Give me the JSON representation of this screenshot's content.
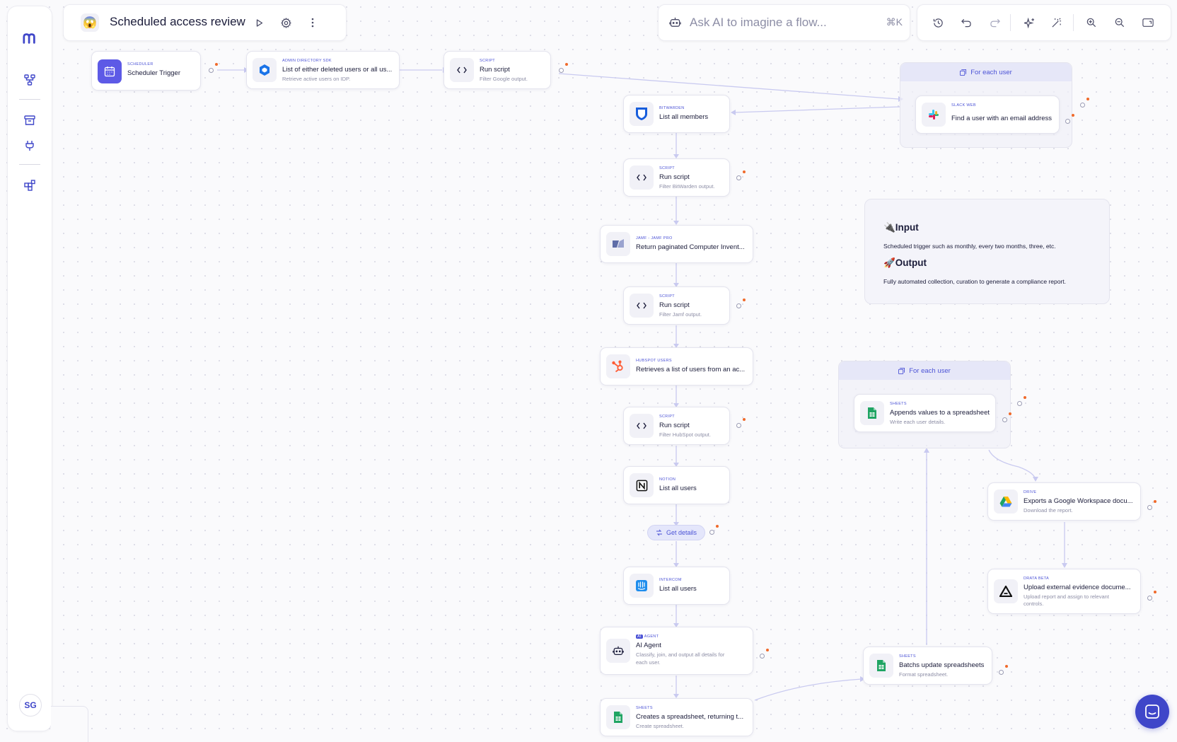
{
  "header": {
    "flow_emoji": "😱",
    "flow_title": "Scheduled access review"
  },
  "ai_bar": {
    "placeholder": "Ask AI to imagine a flow...",
    "shortcut": "⌘K"
  },
  "sidebar": {
    "avatar_initials": "SG"
  },
  "nodes": {
    "scheduler": {
      "category": "Scheduler",
      "title": "Scheduler Trigger",
      "subtitle": ""
    },
    "admin_directory": {
      "category": "Admin Directory SDK",
      "title": "List of either deleted users or all us...",
      "subtitle": "Retrieve active users on IDP."
    },
    "run_script_google": {
      "category": "Script",
      "title": "Run script",
      "subtitle": "Filter Google output."
    },
    "bitwarden": {
      "category": "Bitwarden",
      "title": "List all members",
      "subtitle": ""
    },
    "run_script_bitwarden": {
      "category": "Script",
      "title": "Run script",
      "subtitle": "Filter BitWarden output."
    },
    "jamf": {
      "category": "Jamf - Jamf Pro",
      "title": "Return paginated Computer Invent...",
      "subtitle": ""
    },
    "run_script_jamf": {
      "category": "Script",
      "title": "Run script",
      "subtitle": "Filter Jamf output."
    },
    "hubspot": {
      "category": "HubSpot Users",
      "title": "Retrieves a list of users from an ac...",
      "subtitle": ""
    },
    "run_script_hubspot": {
      "category": "Script",
      "title": "Run script",
      "subtitle": "Filter HubSpot output."
    },
    "notion": {
      "category": "Notion",
      "title": "List all users",
      "subtitle": ""
    },
    "intercom": {
      "category": "Intercom",
      "title": "List all users",
      "subtitle": ""
    },
    "ai_agent": {
      "badge": "AI",
      "category": "Agent",
      "title": "AI Agent",
      "subtitle_line1": "Classify, join, and output all details for",
      "subtitle_line2": "each user."
    },
    "sheets_create": {
      "category": "Sheets",
      "title": "Creates a spreadsheet, returning t...",
      "subtitle": "Create spreadsheet."
    },
    "sheets_batch": {
      "category": "Sheets",
      "title": "Batchs  update spreadsheets",
      "subtitle": "Format spreadsheet."
    },
    "slack_find": {
      "category": "Slack Web",
      "title": "Find a user with an email address",
      "subtitle": ""
    },
    "sheets_append": {
      "category": "Sheets",
      "title": "Appends values to a spreadsheet",
      "subtitle": "Write each user details."
    },
    "drive_export": {
      "category": "Drive",
      "title": "Exports a Google Workspace docu...",
      "subtitle": "Download the report."
    },
    "drata_upload": {
      "category": "Drata Beta",
      "title": "Upload external evidence docume...",
      "subtitle_line1": "Upload report and assign to relevant",
      "subtitle_line2": "controls."
    }
  },
  "groups": {
    "slack_loop": {
      "label": "For each user"
    },
    "sheets_loop": {
      "label": "For each user"
    }
  },
  "get_details": {
    "label": "Get details"
  },
  "note": {
    "input_heading": "🔌Input",
    "input_text": "Scheduled trigger such as monthly, every two months, three, etc.",
    "output_heading": "🚀Output",
    "output_text": "Fully automated collection, curation to generate a compliance report."
  },
  "colors": {
    "accent": "#3f46c9",
    "status_dot": "#f06a2b",
    "edge": "#c9caf0"
  }
}
